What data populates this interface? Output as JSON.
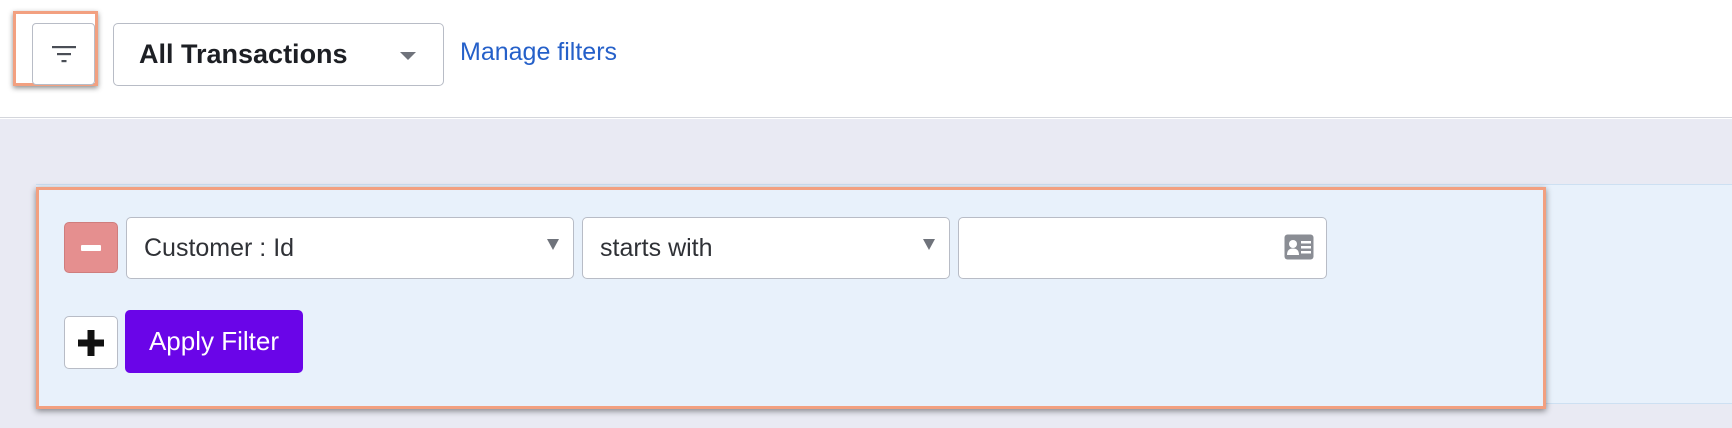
{
  "toolbar": {
    "filter_toggle_icon": "filter-lines-icon",
    "saved_view": "All Transactions",
    "manage_filters_label": "Manage filters"
  },
  "filter_panel": {
    "rows": [
      {
        "field": "Customer : Id",
        "operator": "starts with",
        "value": "",
        "value_placeholder": ""
      }
    ],
    "apply_label": "Apply Filter",
    "remove_icon": "minus-icon",
    "add_icon": "plus-icon",
    "value_icon": "id-card-icon"
  },
  "colors": {
    "highlight": "#f2a080",
    "link": "#2560c9",
    "apply_button": "#6a05e8",
    "remove_button": "#e58f8f",
    "panel_bg": "#e8f1fb",
    "page_bg": "#e9eaf3"
  }
}
